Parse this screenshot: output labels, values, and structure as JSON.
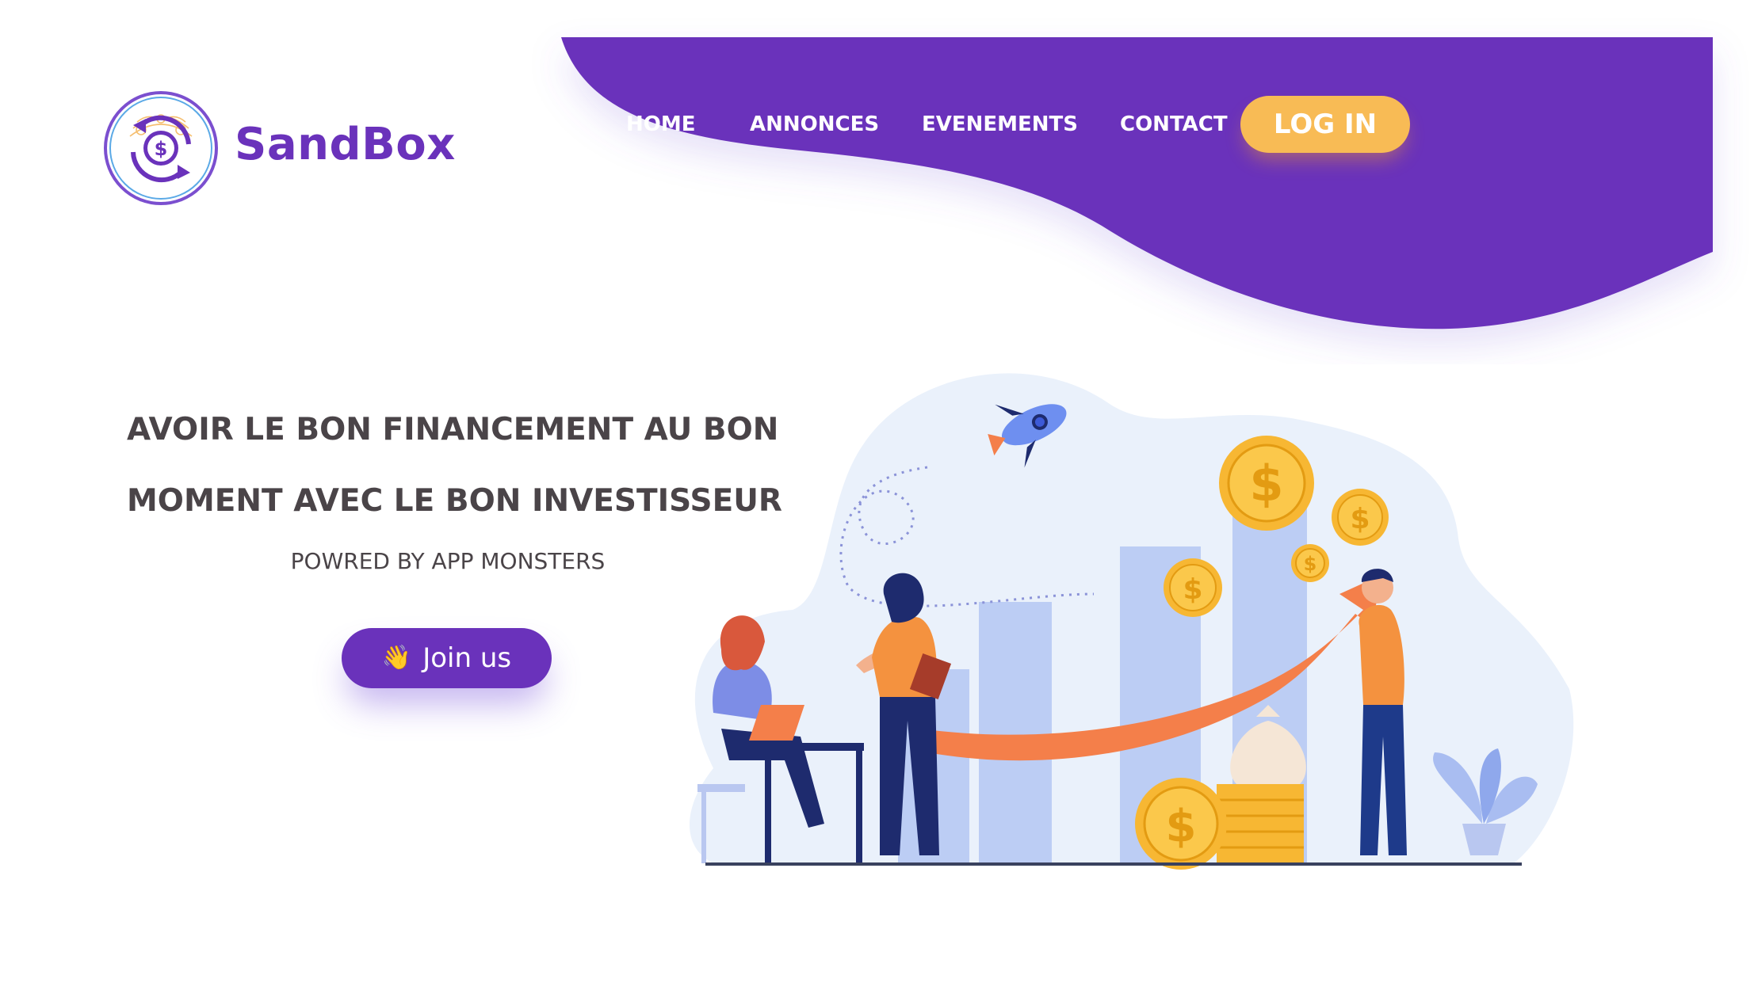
{
  "brand": {
    "name": "SandBox",
    "logo_icon": "money-cycle-logo"
  },
  "nav": {
    "items": [
      {
        "label": "HOME"
      },
      {
        "label": "ANNONCES"
      },
      {
        "label": "EVENEMENTS"
      },
      {
        "label": "CONTACT"
      }
    ],
    "login_label": "LOG IN"
  },
  "hero": {
    "headline_line1": "AVOIR LE BON FINANCEMENT AU BON",
    "headline_line2": "MOMENT AVEC LE BON INVESTISSEUR",
    "subtitle": "POWRED BY APP MONSTERS",
    "cta_label": "Join us",
    "cta_icon": "waving-hand-icon"
  },
  "colors": {
    "primary": "#6a32bb",
    "accent": "#f8bb55",
    "text": "#4a4448",
    "arrow": "#f47f4a",
    "bars": "#bccdf4",
    "blob": "#eaf1fb"
  },
  "illustration": {
    "icons": [
      "rocket-icon",
      "coin-icon",
      "money-bag-icon",
      "plant-icon",
      "laptop-icon",
      "growth-arrow-icon"
    ]
  }
}
